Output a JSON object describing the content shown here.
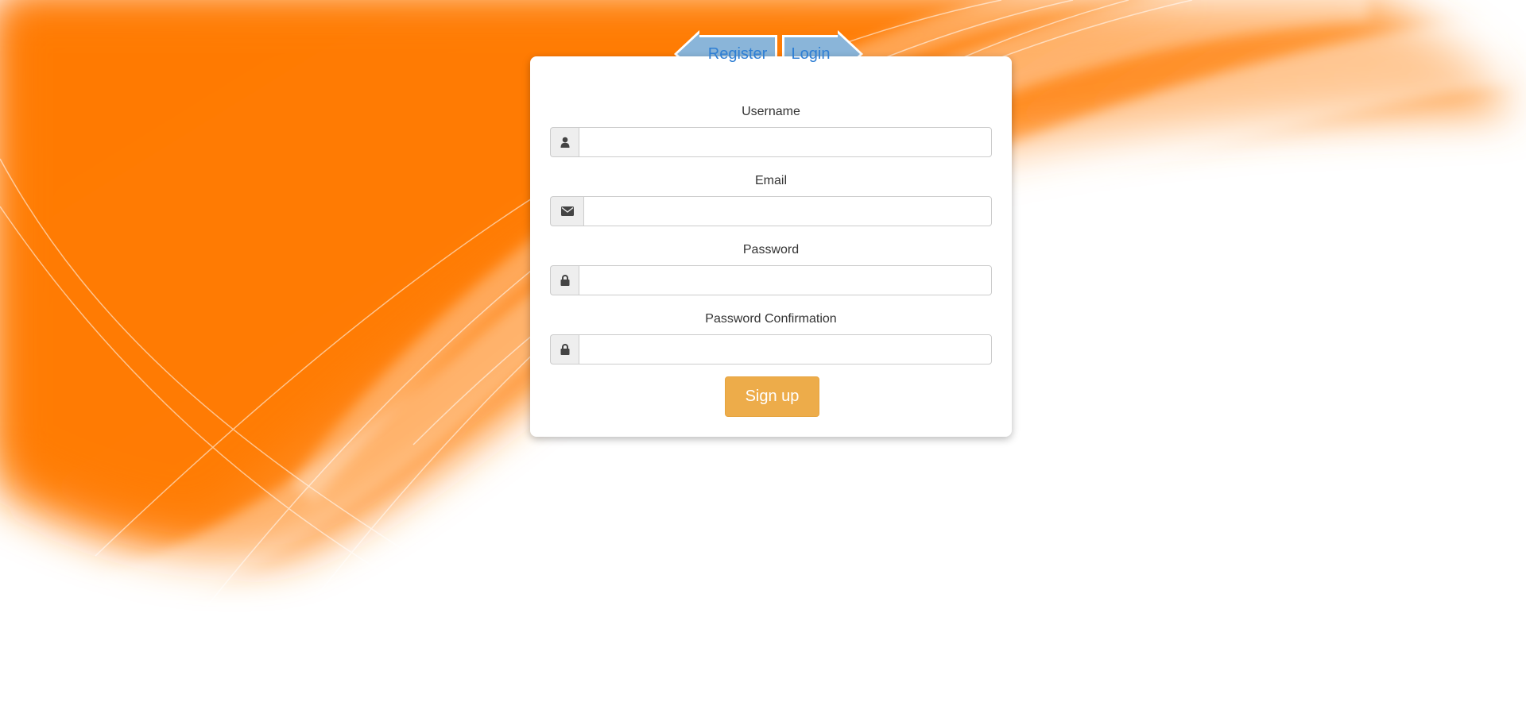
{
  "tabs": {
    "register_label": "Register",
    "login_label": "Login"
  },
  "form": {
    "username": {
      "label": "Username",
      "value": "",
      "icon": "user-icon"
    },
    "email": {
      "label": "Email",
      "value": "",
      "icon": "envelope-icon"
    },
    "password": {
      "label": "Password",
      "value": "",
      "icon": "lock-icon"
    },
    "password_confirmation": {
      "label": "Password Confirmation",
      "value": "",
      "icon": "lock-icon"
    },
    "submit_label": "Sign up"
  },
  "colors": {
    "background_orange": "#ff7f11",
    "tab_blue": "#8ab5d9",
    "tab_text": "#2f7fd4",
    "button": "#edac4a"
  }
}
